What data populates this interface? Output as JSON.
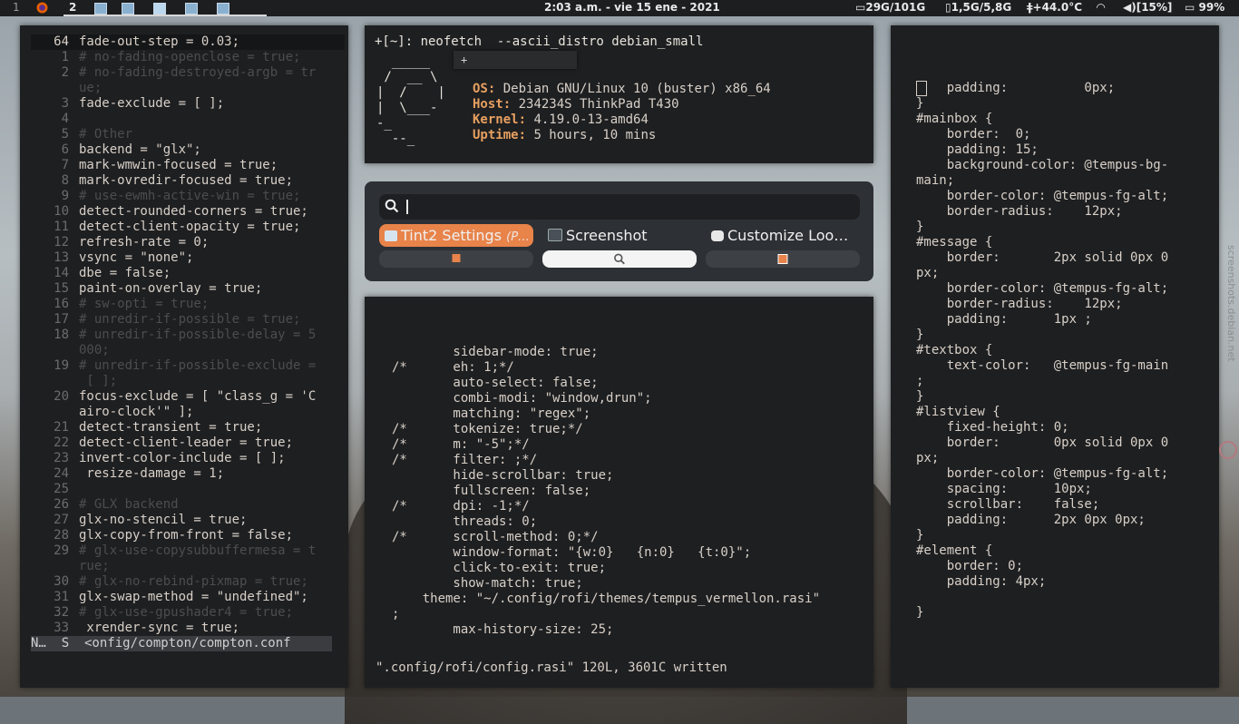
{
  "topbar": {
    "workspace_number": "1",
    "current_workspace": "2",
    "clock": "2:03 a.m. - vie 15 ene - 2021",
    "disk": "29G/101G",
    "memory": "1,5G/5,8G",
    "temperature": "+44.0°C",
    "volume": "[15%]",
    "battery": "99%"
  },
  "vim_left": {
    "lines": [
      {
        "n": "64",
        "t": "fade-out-step = 0.03;",
        "cls": "cur"
      },
      {
        "n": "1",
        "t": "# no-fading-openclose = true;",
        "cls": "cm"
      },
      {
        "n": "2",
        "t": "# no-fading-destroyed-argb = tr",
        "cls": "cm"
      },
      {
        "n": "",
        "t": "ue;",
        "cls": "cm"
      },
      {
        "n": "3",
        "t": "fade-exclude = [ ];",
        "cls": ""
      },
      {
        "n": "4",
        "t": "",
        "cls": ""
      },
      {
        "n": "5",
        "t": "# Other",
        "cls": "cm"
      },
      {
        "n": "6",
        "t": "backend = \"glx\";",
        "cls": ""
      },
      {
        "n": "7",
        "t": "mark-wmwin-focused = true;",
        "cls": ""
      },
      {
        "n": "8",
        "t": "mark-ovredir-focused = true;",
        "cls": ""
      },
      {
        "n": "9",
        "t": "# use-ewmh-active-win = true;",
        "cls": "cm"
      },
      {
        "n": "10",
        "t": "detect-rounded-corners = true;",
        "cls": ""
      },
      {
        "n": "11",
        "t": "detect-client-opacity = true;",
        "cls": ""
      },
      {
        "n": "12",
        "t": "refresh-rate = 0;",
        "cls": ""
      },
      {
        "n": "13",
        "t": "vsync = \"none\";",
        "cls": ""
      },
      {
        "n": "14",
        "t": "dbe = false;",
        "cls": ""
      },
      {
        "n": "15",
        "t": "paint-on-overlay = true;",
        "cls": ""
      },
      {
        "n": "16",
        "t": "# sw-opti = true;",
        "cls": "cm"
      },
      {
        "n": "17",
        "t": "# unredir-if-possible = true;",
        "cls": "cm"
      },
      {
        "n": "18",
        "t": "# unredir-if-possible-delay = 5",
        "cls": "cm"
      },
      {
        "n": "",
        "t": "000;",
        "cls": "cm"
      },
      {
        "n": "19",
        "t": "# unredir-if-possible-exclude =",
        "cls": "cm"
      },
      {
        "n": "",
        "t": " [ ];",
        "cls": "cm"
      },
      {
        "n": "20",
        "t": "focus-exclude = [ \"class_g = 'C",
        "cls": ""
      },
      {
        "n": "",
        "t": "airo-clock'\" ];",
        "cls": ""
      },
      {
        "n": "21",
        "t": "detect-transient = true;",
        "cls": ""
      },
      {
        "n": "22",
        "t": "detect-client-leader = true;",
        "cls": ""
      },
      {
        "n": "23",
        "t": "invert-color-include = [ ];",
        "cls": ""
      },
      {
        "n": "24",
        "t": " resize-damage = 1;",
        "cls": ""
      },
      {
        "n": "25",
        "t": "",
        "cls": ""
      },
      {
        "n": "26",
        "t": "# GLX backend",
        "cls": "cm"
      },
      {
        "n": "27",
        "t": "glx-no-stencil = true;",
        "cls": ""
      },
      {
        "n": "28",
        "t": "glx-copy-from-front = false;",
        "cls": ""
      },
      {
        "n": "29",
        "t": "# glx-use-copysubbuffermesa = t",
        "cls": "cm"
      },
      {
        "n": "",
        "t": "rue;",
        "cls": "cm"
      },
      {
        "n": "30",
        "t": "# glx-no-rebind-pixmap = true;",
        "cls": "cm"
      },
      {
        "n": "31",
        "t": "glx-swap-method = \"undefined\";",
        "cls": ""
      },
      {
        "n": "32",
        "t": "# glx-use-gpushader4 = true;",
        "cls": "cm"
      },
      {
        "n": "33",
        "t": " xrender-sync = true;",
        "cls": ""
      }
    ],
    "status": "N…  S  <onfig/compton/compton.conf"
  },
  "neofetch": {
    "prompt": "+[~]: neofetch  --ascii_distro debian_small",
    "logo": [
      "  _____",
      " /  __ \\",
      "|  /    |",
      "|  \\___-",
      "-_",
      "  --_"
    ],
    "info": [
      {
        "k": "OS:",
        "v": " Debian GNU/Linux 10 (buster) x86_64"
      },
      {
        "k": "Host:",
        "v": " 234234S ThinkPad T430"
      },
      {
        "k": "Kernel:",
        "v": " 4.19.0-13-amd64"
      },
      {
        "k": "Uptime:",
        "v": " 5 hours, 10 mins"
      }
    ],
    "tooltip_plus": "+"
  },
  "rofi": {
    "entries": [
      {
        "label": "Tint2 Settings",
        "sub": "(P…",
        "selected": true
      },
      {
        "label": "Screenshot",
        "sub": "",
        "selected": false
      },
      {
        "label": "Customize Loo…",
        "sub": "",
        "selected": false
      }
    ]
  },
  "vim_middle": {
    "lines": [
      "",
      "",
      "        sidebar-mode: true;",
      "/*      eh: 1;*/",
      "        auto-select: false;",
      "        combi-modi: \"window,drun\";",
      "        matching: \"regex\";",
      "/*      tokenize: true;*/",
      "/*      m: \"-5\";*/",
      "/*      filter: ;*/",
      "        hide-scrollbar: true;",
      "        fullscreen: false;",
      "/*      dpi: -1;*/",
      "        threads: 0;",
      "/*      scroll-method: 0;*/",
      "        window-format: \"{w:0}   {n:0}   {t:0}\";",
      "        click-to-exit: true;",
      "        show-match: true;",
      "    theme: \"~/.config/rofi/themes/tempus_vermellon.rasi\"",
      ";",
      "        max-history-size: 25;"
    ],
    "message": "\".config/rofi/config.rasi\" 120L, 3601C written"
  },
  "vim_right": {
    "lines": [
      "    padding:          0px;",
      "}",
      "#mainbox {",
      "    border:  0;",
      "    padding: 15;",
      "    background-color: @tempus-bg-",
      "main;",
      "    border-color: @tempus-fg-alt;",
      "    border-radius:    12px;",
      "}",
      "#message {",
      "    border:       2px solid 0px 0",
      "px;",
      "    border-color: @tempus-fg-alt;",
      "    border-radius:    12px;",
      "    padding:      1px ;",
      "}",
      "#textbox {",
      "    text-color:   @tempus-fg-main",
      ";",
      "}",
      "#listview {",
      "    fixed-height: 0;",
      "    border:       0px solid 0px 0",
      "px;",
      "    border-color: @tempus-fg-alt;",
      "    spacing:      10px;",
      "    scrollbar:    false;",
      "    padding:      2px 0px 0px;",
      "}",
      "#element {",
      "    border: 0;",
      "    padding: 4px;",
      "",
      "}"
    ]
  },
  "watermark": "screenshots.debian.net"
}
